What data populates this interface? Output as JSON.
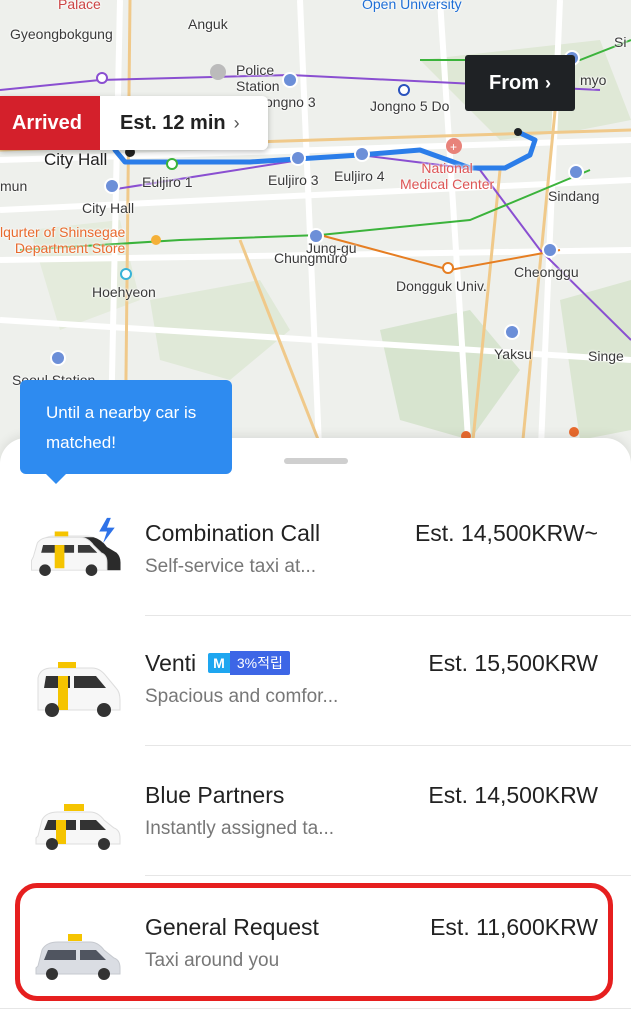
{
  "map": {
    "labels": {
      "palace": "Palace",
      "anguk": "Anguk",
      "open_university": "Open University",
      "gyeongbokgung": "Gyeongbokgung",
      "police_station": "Police\nStation",
      "jongno3": "Jongno 3",
      "jongno5": "Jongno 5 Do",
      "myo": "myo",
      "si": "Si",
      "city_hall_big": "City Hall",
      "mun": "mun",
      "euljiro1": "Euljiro 1",
      "euljiro3": "Euljiro 3",
      "euljiro4": "Euljiro 4",
      "national_medical": "National\nMedical Center",
      "sindang": "Sindang",
      "city_hall": "City Hall",
      "shinsegae": "lqurter of Shinsegae\nDepartment Store",
      "chungmuro": "Chungmuro",
      "junggu": "Jung-gu",
      "cheonggu": "Cheonggu",
      "hoehyeon": "Hoehyeon",
      "dongguk": "Dongguk Univ.",
      "yaksu": "Yaksu",
      "singe": "Singe",
      "seoul_station": "Seoul Station"
    }
  },
  "arrived_pill": {
    "status": "Arrived",
    "estimate": "Est. 12 min",
    "chevron": "›"
  },
  "from_pill": {
    "label": "From",
    "chevron": "›"
  },
  "tooltip": {
    "text": "Until a nearby car is matched!"
  },
  "options": [
    {
      "name": "Combination Call",
      "description": "Self-service taxi at...",
      "price": "Est. 14,500KRW~",
      "icon": "combination-taxi-icon"
    },
    {
      "name": "Venti",
      "description": "Spacious and comfor...",
      "price": "Est. 15,500KRW",
      "badge_m": "M",
      "badge_points": "3%적립",
      "icon": "venti-van-icon"
    },
    {
      "name": "Blue Partners",
      "description": "Instantly assigned ta...",
      "price": "Est. 14,500KRW",
      "icon": "blue-taxi-icon"
    },
    {
      "name": "General Request",
      "description": "Taxi around you",
      "price": "Est. 11,600KRW",
      "icon": "general-taxi-icon"
    }
  ],
  "colors": {
    "arrived_red": "#d4202b",
    "route_blue": "#2b7de9",
    "tooltip_blue": "#2e8bf0",
    "highlight_red": "#e61f1f"
  }
}
